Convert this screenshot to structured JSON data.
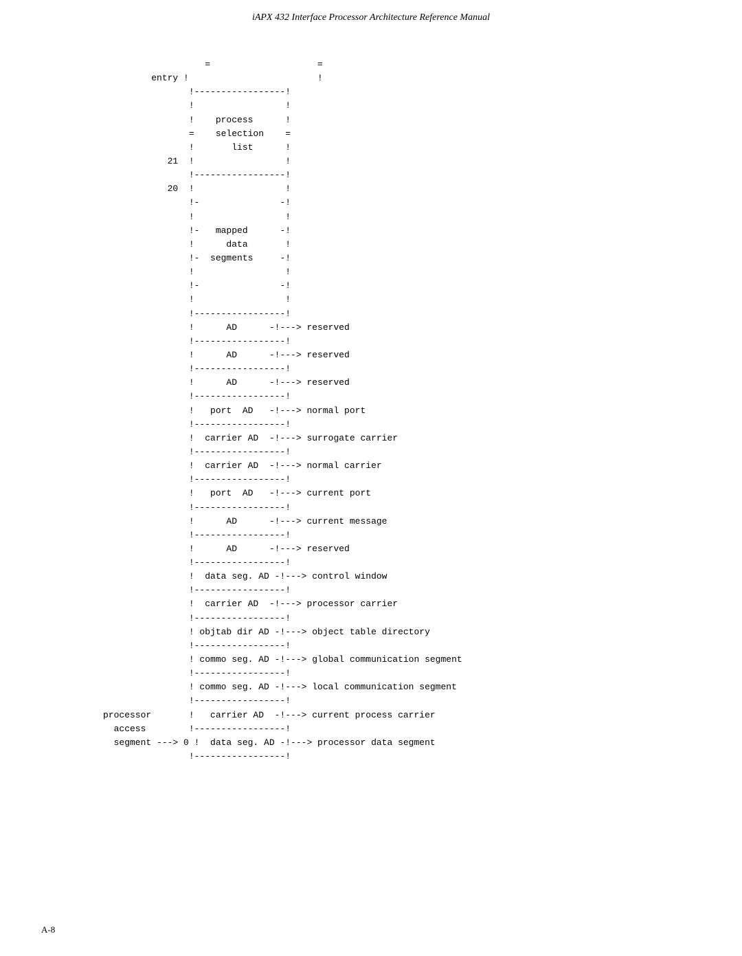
{
  "header": {
    "title": "iAPX 432 Interface Processor Architecture Reference Manual"
  },
  "footer": {
    "page": "A-8"
  },
  "diagram": {
    "content": "                   =                    =\n         entry !                        !\n                !-----------------!\n                !                 !\n                !    process      !\n                =    selection    =\n                !       list      !\n            21  !                 !\n                !-----------------!\n            20  !                 !\n                !-               -!\n                !                 !\n                !-   mapped      -!\n                !      data       !\n                !-  segments     -!\n                !                 !\n                !-               -!\n                !                 !\n                !-----------------!\n                !      AD      -!---> reserved\n                !-----------------!\n                !      AD      -!---> reserved\n                !-----------------!\n                !      AD      -!---> reserved\n                !-----------------!\n                !   port  AD   -!---> normal port\n                !-----------------!\n                !  carrier AD  -!---> surrogate carrier\n                !-----------------!\n                !  carrier AD  -!---> normal carrier\n                !-----------------!\n                !   port  AD   -!---> current port\n                !-----------------!\n                !      AD      -!---> current message\n                !-----------------!\n                !      AD      -!---> reserved\n                !-----------------!\n                !  data seg. AD -!---> control window\n                !-----------------!\n                !  carrier AD  -!---> processor carrier\n                !-----------------!\n                ! objtab dir AD -!---> object table directory\n                !-----------------!\n                ! commo seg. AD -!---> global communication segment\n                !-----------------!\n                ! commo seg. AD -!---> local communication segment\n                !-----------------!\nprocessor       !   carrier AD  -!---> current process carrier\n  access        !-----------------!\n  segment ---> 0 !  data seg. AD -!---> processor data segment\n                !-----------------!"
  }
}
